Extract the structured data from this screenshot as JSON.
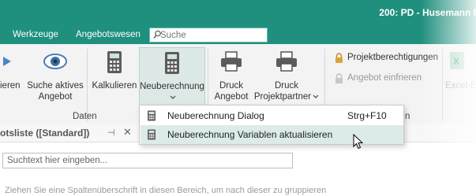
{
  "titlebar": {
    "title": "200: PD - Husemann I"
  },
  "menubar": {
    "items": [
      "Werkzeuge",
      "Angebotswesen"
    ],
    "search_placeholder": "Suche"
  },
  "ribbon": {
    "buttons": {
      "partial": "ieren",
      "suche_aktives_angebot_line1": "Suche aktives",
      "suche_aktives_angebot_line2": "Angebot",
      "kalkulieren": "Kalkulieren",
      "neuberechnung": "Neuberechnung",
      "druck_angebot_line1": "Druck",
      "druck_angebot_line2": "Angebot",
      "druck_projektpartner_line1": "Druck",
      "druck_projektpartner_line2": "Projektpartner",
      "projektberechtigungen": "Projektberechtigungen",
      "angebot_einfrieren": "Angebot einfrieren",
      "excel_partial": "Excel-E"
    },
    "groups": {
      "daten": "Daten",
      "partial_right": "n"
    }
  },
  "dropdown": {
    "items": [
      {
        "label": "Neuberechnung Dialog",
        "shortcut": "Strg+F10"
      },
      {
        "label": "Neuberechnung Variablen aktualisieren",
        "shortcut": ""
      }
    ]
  },
  "tabbar": {
    "title": "otsliste ([Standard])"
  },
  "filter": {
    "placeholder": "Suchtext hier eingeben..."
  },
  "group_hint": "Ziehen Sie eine Spaltenüberschrift in diesen Bereich, um nach dieser zu gruppieren",
  "colors": {
    "accent": "#1f8f7e",
    "hover": "#dcebe8",
    "ribbon_bg": "#f3f3f3"
  },
  "icons": [
    "search-icon",
    "eye-icon",
    "calculator-icon",
    "printer-icon",
    "lock-icon",
    "excel-icon",
    "pin-icon",
    "close-icon",
    "chevron-down-icon",
    "cursor-icon"
  ]
}
